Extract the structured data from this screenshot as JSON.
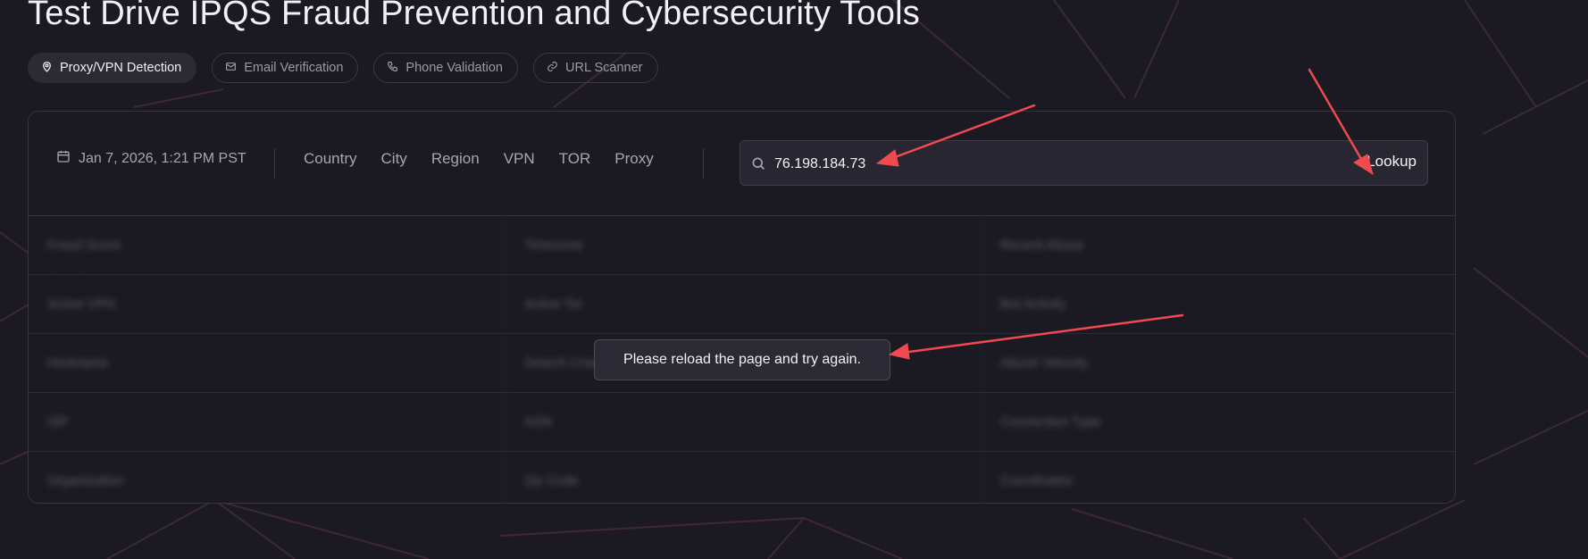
{
  "page_title": "Test Drive IPQS Fraud Prevention and Cybersecurity Tools",
  "tabs": [
    {
      "label": "Proxy/VPN Detection",
      "icon": "map-pin-icon",
      "active": true
    },
    {
      "label": "Email Verification",
      "icon": "mail-icon",
      "active": false
    },
    {
      "label": "Phone Validation",
      "icon": "phone-icon",
      "active": false
    },
    {
      "label": "URL Scanner",
      "icon": "link-icon",
      "active": false
    }
  ],
  "header": {
    "date": "Jan 7, 2026, 1:21 PM PST",
    "filters": [
      "Country",
      "City",
      "Region",
      "VPN",
      "TOR",
      "Proxy"
    ]
  },
  "search": {
    "value": "76.198.184.73",
    "button_label": "Lookup"
  },
  "results": {
    "rows": [
      [
        "Fraud Score",
        "Timezone",
        "Recent Abuse"
      ],
      [
        "Active VPN",
        "Active Tor",
        "Bot Activity"
      ],
      [
        "Hostname",
        "Search Crawler",
        "Abuse Velocity"
      ],
      [
        "ISP",
        "ASN",
        "Connection Type"
      ],
      [
        "Organization",
        "Zip Code",
        "Coordinates"
      ]
    ]
  },
  "toast": {
    "message": "Please reload the page and try again."
  },
  "colors": {
    "background": "#1b1a22",
    "card_border": "#34333e",
    "annotation_arrow": "#f04a4f"
  }
}
